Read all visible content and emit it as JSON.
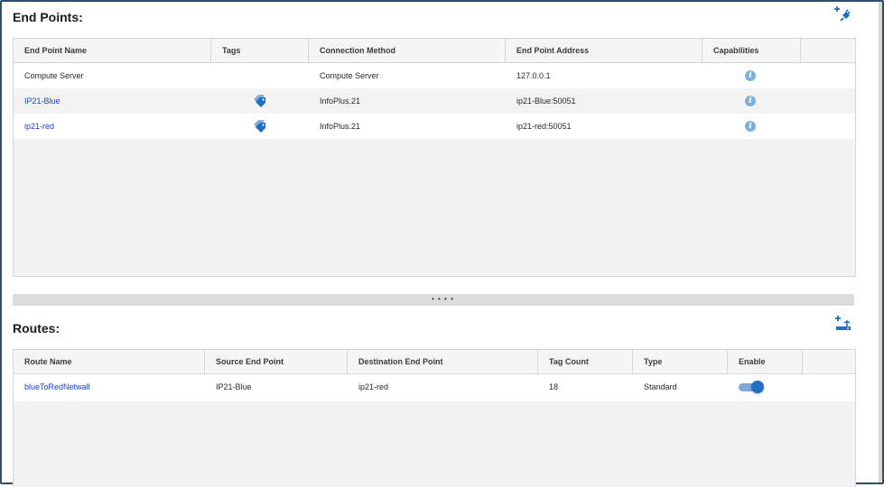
{
  "endpoints": {
    "title": "End Points:",
    "add_icon": "add-plug-icon",
    "columns": [
      "End Point Name",
      "Tags",
      "Connection Method",
      "End Point Address",
      "Capabilities"
    ],
    "rows": [
      {
        "name": "Compute Server",
        "has_tag": false,
        "method": "Compute Server",
        "address": "127.0.0.1",
        "link": false
      },
      {
        "name": "IP21-Blue",
        "has_tag": true,
        "method": "InfoPlus.21",
        "address": "ip21-Blue:50051",
        "link": true
      },
      {
        "name": "ip21-red",
        "has_tag": true,
        "method": "InfoPlus.21",
        "address": "ip21-red:50051",
        "link": true
      }
    ],
    "info_glyph": "i"
  },
  "splitter": {
    "dots": "• • • •"
  },
  "routes": {
    "title": "Routes:",
    "add_icon": "add-route-icon",
    "columns": [
      "Route Name",
      "Source End Point",
      "Destination End Point",
      "Tag Count",
      "Type",
      "Enable"
    ],
    "rows": [
      {
        "name": "blueToRedNetwall",
        "source": "IP21-Blue",
        "destination": "ip21-red",
        "tag_count": "18",
        "type": "Standard",
        "enabled": true
      }
    ]
  },
  "colors": {
    "accent": "#1e6fc4",
    "link": "#1a3fcc",
    "border": "#2d4f6e"
  }
}
